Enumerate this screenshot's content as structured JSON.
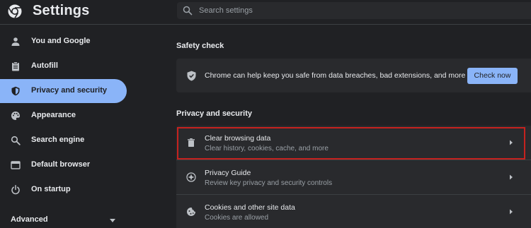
{
  "header": {
    "title": "Settings",
    "logo_icon": "chrome-logo-icon",
    "search_placeholder": "Search settings"
  },
  "sidebar": {
    "items": [
      {
        "label": "You and Google",
        "icon": "person-icon",
        "active": false
      },
      {
        "label": "Autofill",
        "icon": "clipboard-icon",
        "active": false
      },
      {
        "label": "Privacy and security",
        "icon": "shield-icon",
        "active": true
      },
      {
        "label": "Appearance",
        "icon": "palette-icon",
        "active": false
      },
      {
        "label": "Search engine",
        "icon": "search-icon",
        "active": false
      },
      {
        "label": "Default browser",
        "icon": "browser-window-icon",
        "active": false
      },
      {
        "label": "On startup",
        "icon": "power-icon",
        "active": false
      }
    ],
    "advanced_label": "Advanced"
  },
  "safety_check": {
    "section_title": "Safety check",
    "description": "Chrome can help keep you safe from data breaches, bad extensions, and more",
    "button_label": "Check now"
  },
  "privacy": {
    "section_title": "Privacy and security",
    "rows": [
      {
        "title": "Clear browsing data",
        "subtitle": "Clear history, cookies, cache, and more",
        "icon": "trash-icon",
        "highlighted": true
      },
      {
        "title": "Privacy Guide",
        "subtitle": "Review key privacy and security controls",
        "icon": "compass-icon",
        "highlighted": false
      },
      {
        "title": "Cookies and other site data",
        "subtitle": "Cookies are allowed",
        "icon": "cookie-icon",
        "highlighted": false
      }
    ]
  },
  "colors": {
    "background": "#202124",
    "card": "#292a2d",
    "accent": "#8ab4f8",
    "highlight": "#c5221f"
  }
}
